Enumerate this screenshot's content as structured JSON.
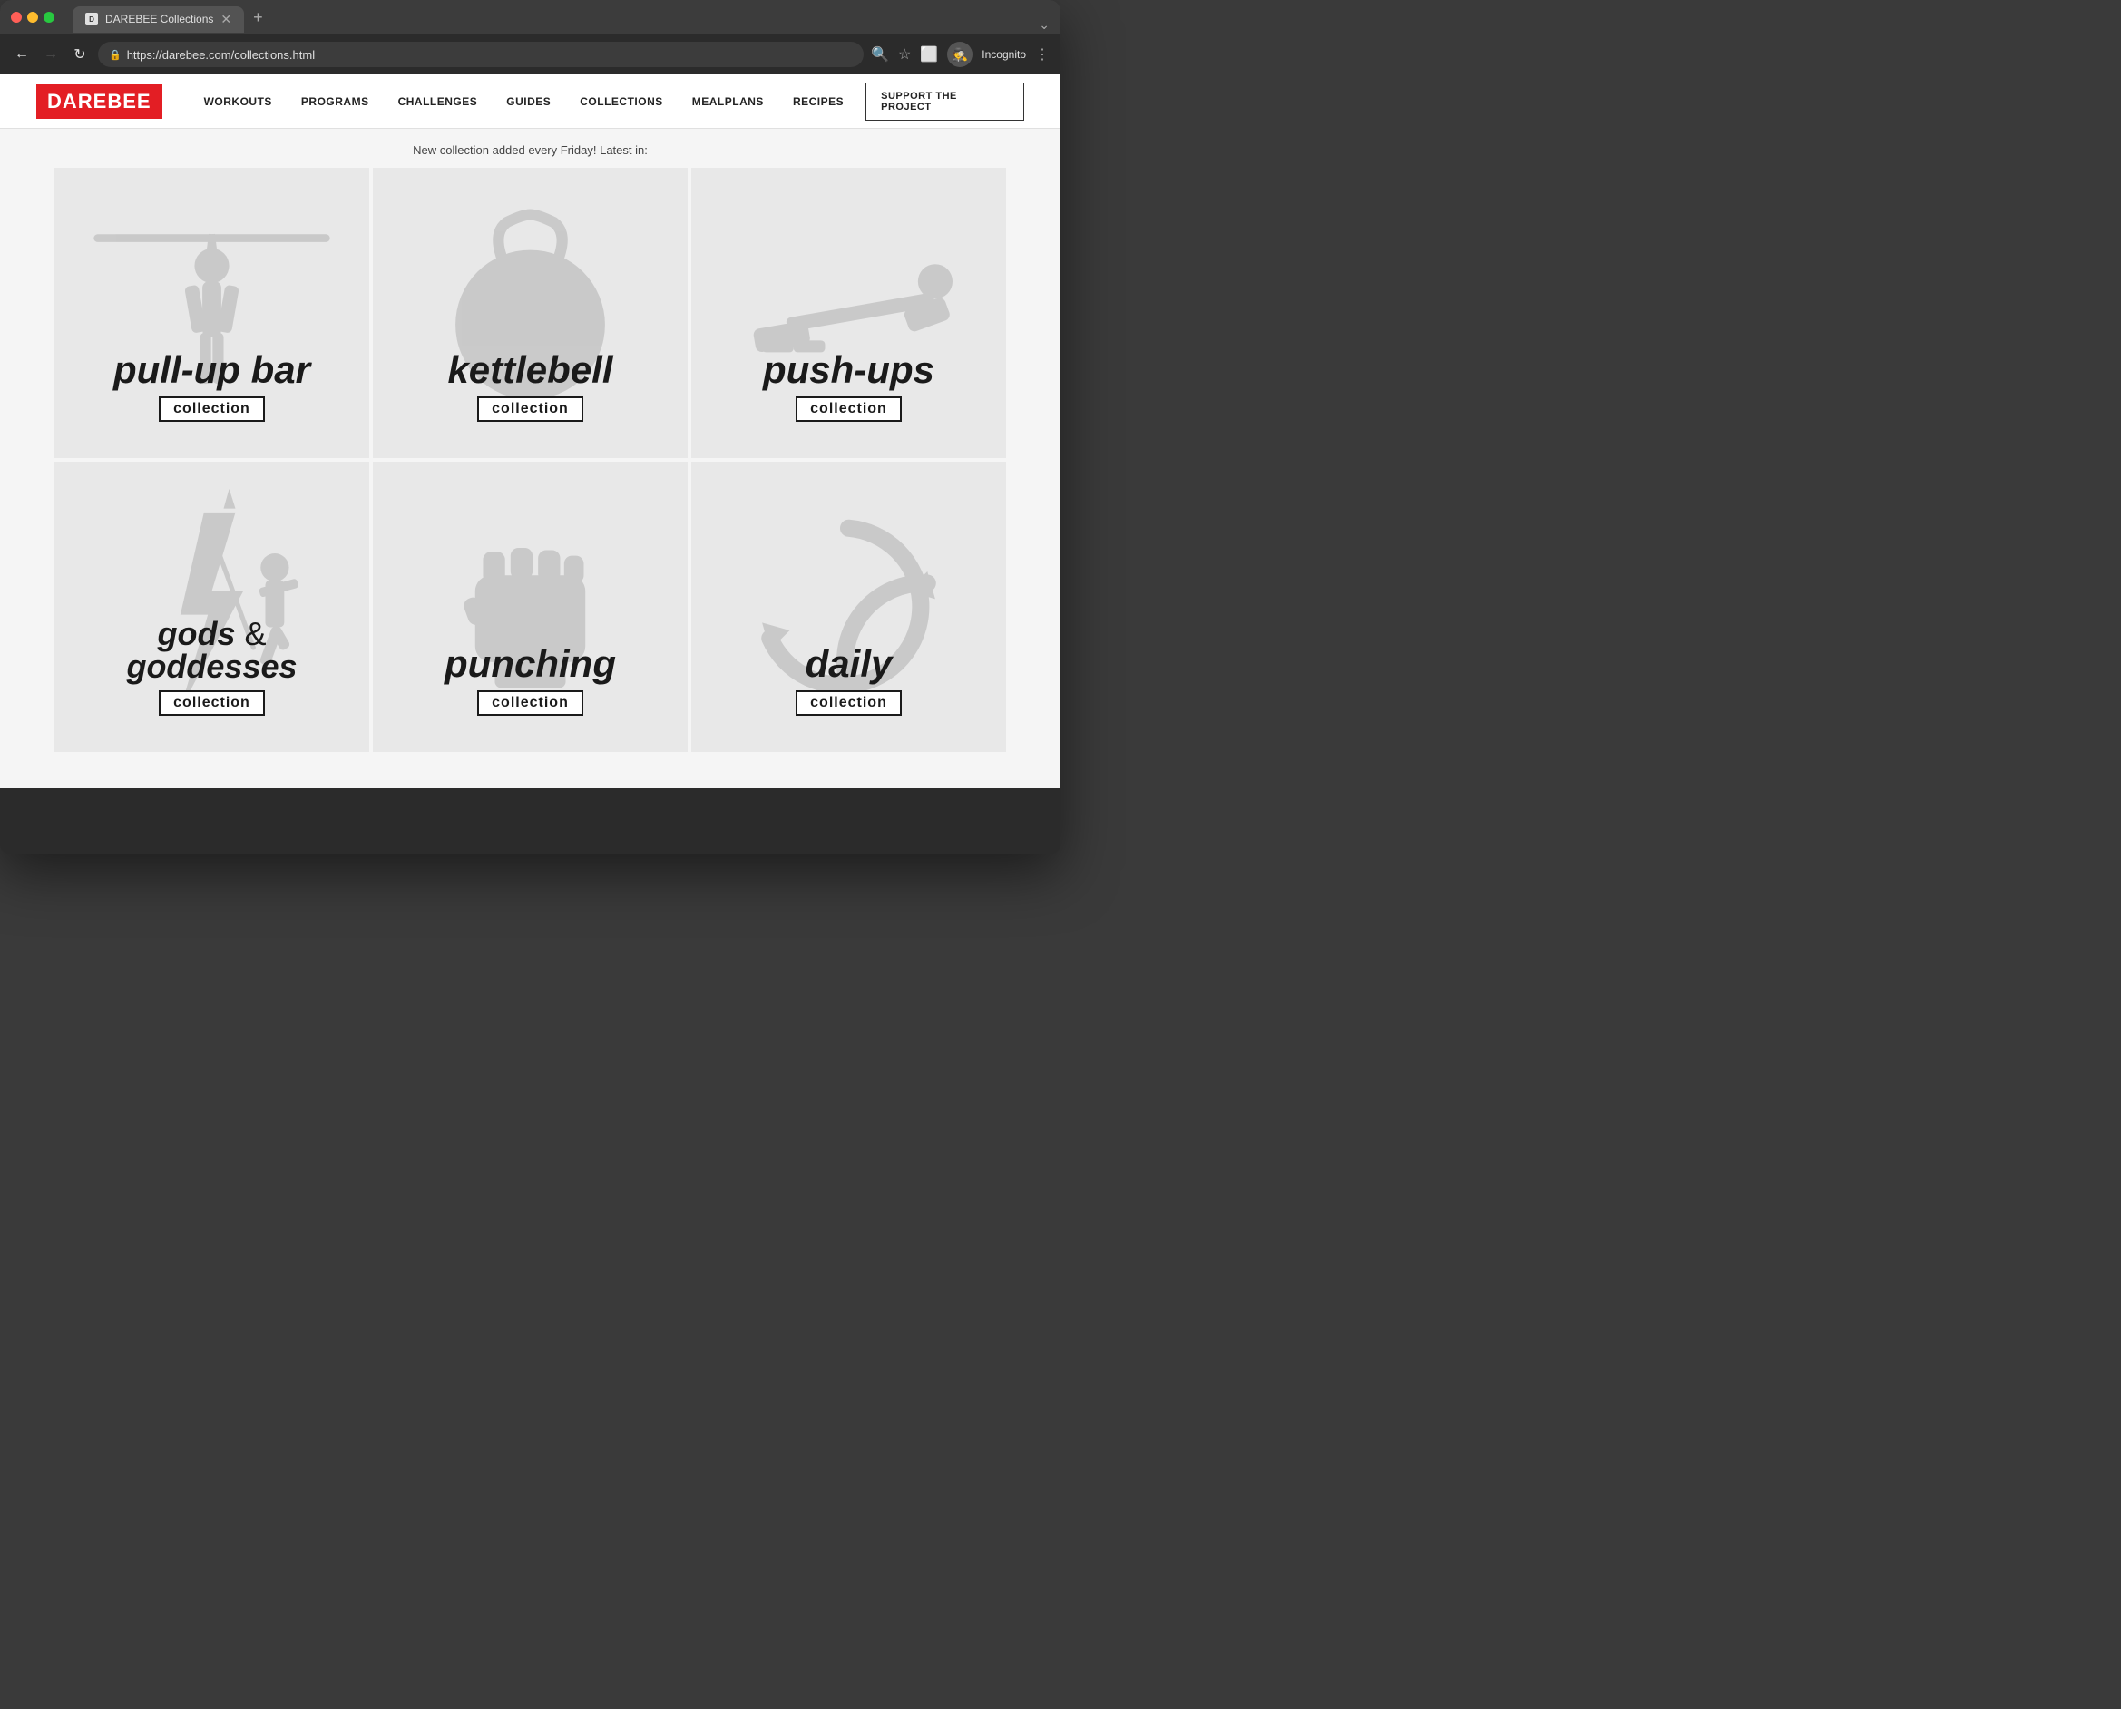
{
  "browser": {
    "tab_title": "DAREBEE Collections",
    "url": "https://darebee.com/collections.html",
    "incognito_label": "Incognito",
    "new_tab_symbol": "+"
  },
  "nav": {
    "logo": "DAREBEE",
    "links": [
      {
        "label": "WORKOUTS",
        "href": "#"
      },
      {
        "label": "PROGRAMS",
        "href": "#"
      },
      {
        "label": "CHALLENGES",
        "href": "#"
      },
      {
        "label": "GUIDES",
        "href": "#"
      },
      {
        "label": "COLLECTIONS",
        "href": "#"
      },
      {
        "label": "MEALPLANS",
        "href": "#"
      },
      {
        "label": "RECIPES",
        "href": "#"
      }
    ],
    "support_label": "SUPPORT THE PROJECT"
  },
  "main": {
    "announcement": "New collection added every Friday! Latest in:",
    "collections": [
      {
        "title": "pull-up bar",
        "subtitle": "collection",
        "bg_type": "pullup"
      },
      {
        "title": "kettlebell",
        "subtitle": "collection",
        "bg_type": "kettlebell"
      },
      {
        "title": "push-ups",
        "subtitle": "collection",
        "bg_type": "pushup"
      },
      {
        "title": "gods & goddesses",
        "subtitle": "collection",
        "bg_type": "gods",
        "title_line1": "gods &",
        "title_line2": "goddesses"
      },
      {
        "title": "punching",
        "subtitle": "collection",
        "bg_type": "punching"
      },
      {
        "title": "daily",
        "subtitle": "collection",
        "bg_type": "daily"
      }
    ]
  }
}
